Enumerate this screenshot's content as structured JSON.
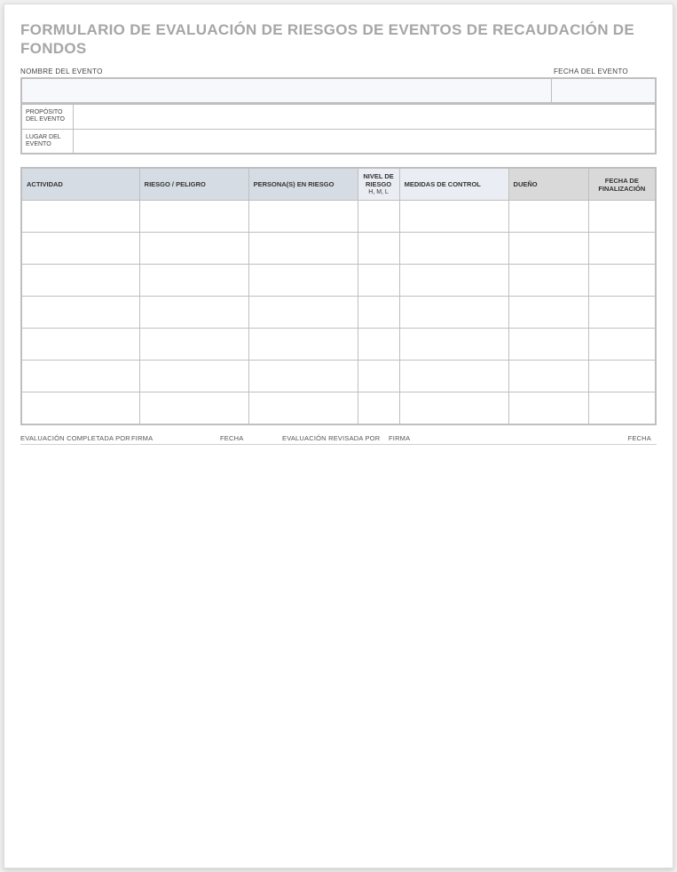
{
  "title": "FORMULARIO DE EVALUACIÓN DE RIESGOS DE EVENTOS DE RECAUDACIÓN DE FONDOS",
  "header": {
    "event_name_label": "NOMBRE DEL EVENTO",
    "event_date_label": "FECHA DEL EVENTO",
    "event_name_value": "",
    "event_date_value": ""
  },
  "info": {
    "purpose_label": "PROPÓSITO DEL EVENTO",
    "purpose_value": "",
    "venue_label": "LUGAR DEL EVENTO",
    "venue_value": ""
  },
  "risk_table": {
    "columns": {
      "activity": "ACTIVIDAD",
      "hazard": "RIESGO / PELIGRO",
      "persons": "PERSONA(S) EN RIESGO",
      "level": "NIVEL DE RIESGO",
      "level_sub": "H, M, L",
      "controls": "MEDIDAS DE CONTROL",
      "owner": "DUEÑO",
      "completion": "FECHA DE FINALIZACIÓN"
    },
    "rows": [
      {
        "activity": "",
        "hazard": "",
        "persons": "",
        "level": "",
        "controls": "",
        "owner": "",
        "completion": ""
      },
      {
        "activity": "",
        "hazard": "",
        "persons": "",
        "level": "",
        "controls": "",
        "owner": "",
        "completion": ""
      },
      {
        "activity": "",
        "hazard": "",
        "persons": "",
        "level": "",
        "controls": "",
        "owner": "",
        "completion": ""
      },
      {
        "activity": "",
        "hazard": "",
        "persons": "",
        "level": "",
        "controls": "",
        "owner": "",
        "completion": ""
      },
      {
        "activity": "",
        "hazard": "",
        "persons": "",
        "level": "",
        "controls": "",
        "owner": "",
        "completion": ""
      },
      {
        "activity": "",
        "hazard": "",
        "persons": "",
        "level": "",
        "controls": "",
        "owner": "",
        "completion": ""
      },
      {
        "activity": "",
        "hazard": "",
        "persons": "",
        "level": "",
        "controls": "",
        "owner": "",
        "completion": ""
      }
    ]
  },
  "footer": {
    "completed_by": "EVALUACIÓN COMPLETADA POR",
    "signature1": "FIRMA",
    "date1": "FECHA",
    "reviewed_by": "EVALUACIÓN REVISADA POR",
    "signature2": "FIRMA",
    "date2": "FECHA"
  }
}
